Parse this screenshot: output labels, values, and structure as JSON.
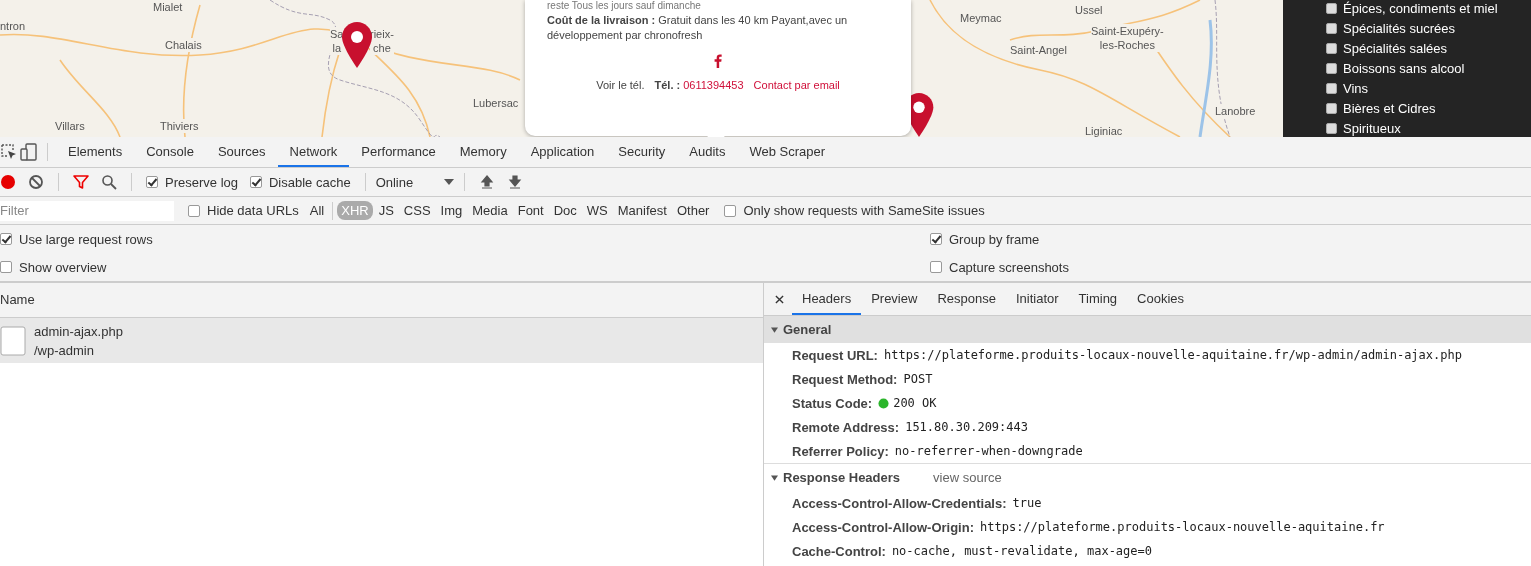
{
  "map": {
    "labels": [
      {
        "lines": [
          "ntron"
        ]
      },
      {
        "lines": [
          "Mialet"
        ]
      },
      {
        "lines": [
          "Chalais"
        ]
      },
      {
        "lines": [
          "Villars"
        ]
      },
      {
        "lines": [
          "Thiviers"
        ]
      },
      {
        "lines": [
          "Sa",
          "la"
        ]
      },
      {
        "lines": [
          "rieix-",
          "che"
        ]
      },
      {
        "lines": [
          "Lubersac"
        ]
      },
      {
        "lines": [
          "Meymac"
        ]
      },
      {
        "lines": [
          "Ussel"
        ]
      },
      {
        "lines": [
          "Saint-Exupéry-",
          "les-Roches"
        ]
      },
      {
        "lines": [
          "Saint-Angel"
        ]
      },
      {
        "lines": [
          "Lanobre"
        ]
      },
      {
        "lines": [
          "Liginiac"
        ]
      }
    ],
    "popup": {
      "hours": "reste Tous les jours sauf dimanche",
      "delivery_label": "Coût de la livraison :",
      "delivery_text": "Gratuit dans les 40 km Payant,avec un développement par chronofresh",
      "show_phone": "Voir le tél.",
      "phone_label": "Tél. :",
      "phone": "0611394453",
      "email_link": "Contact par email"
    }
  },
  "categories": [
    {
      "label": "Épices, condiments et miel",
      "checked": false
    },
    {
      "label": "Spécialités sucrées",
      "checked": false
    },
    {
      "label": "Spécialités salées",
      "checked": false
    },
    {
      "label": "Boissons sans alcool",
      "checked": false
    },
    {
      "label": "Vins",
      "checked": false
    },
    {
      "label": "Bières et Cidres",
      "checked": false
    },
    {
      "label": "Spiritueux",
      "checked": false
    }
  ],
  "devtools": {
    "tabs": [
      {
        "label": "Elements",
        "selected": false
      },
      {
        "label": "Console",
        "selected": false
      },
      {
        "label": "Sources",
        "selected": false
      },
      {
        "label": "Network",
        "selected": true
      },
      {
        "label": "Performance",
        "selected": false
      },
      {
        "label": "Memory",
        "selected": false
      },
      {
        "label": "Application",
        "selected": false
      },
      {
        "label": "Security",
        "selected": false
      },
      {
        "label": "Audits",
        "selected": false
      },
      {
        "label": "Web Scraper",
        "selected": false
      }
    ],
    "toolbar": {
      "recording": true,
      "preserve_log": {
        "label": "Preserve log",
        "checked": true
      },
      "disable_cache": {
        "label": "Disable cache",
        "checked": true
      },
      "throttling": "Online"
    },
    "filter": {
      "placeholder": "Filter",
      "hide_data_urls": {
        "label": "Hide data URLs",
        "checked": false
      },
      "types": [
        {
          "label": "All",
          "selected": false
        },
        {
          "label": "XHR",
          "selected": true
        },
        {
          "label": "JS",
          "selected": false
        },
        {
          "label": "CSS",
          "selected": false
        },
        {
          "label": "Img",
          "selected": false
        },
        {
          "label": "Media",
          "selected": false
        },
        {
          "label": "Font",
          "selected": false
        },
        {
          "label": "Doc",
          "selected": false
        },
        {
          "label": "WS",
          "selected": false
        },
        {
          "label": "Manifest",
          "selected": false
        },
        {
          "label": "Other",
          "selected": false
        }
      ],
      "samesite": {
        "label": "Only show requests with SameSite issues",
        "checked": false
      }
    },
    "settings_left": [
      {
        "label": "Use large request rows",
        "checked": true
      },
      {
        "label": "Show overview",
        "checked": false
      }
    ],
    "settings_right": [
      {
        "label": "Group by frame",
        "checked": true
      },
      {
        "label": "Capture screenshots",
        "checked": false
      }
    ],
    "requests_header": "Name",
    "requests": [
      {
        "name": "admin-ajax.php",
        "path": "/wp-admin",
        "selected": true
      }
    ],
    "detail_tabs": [
      {
        "label": "Headers",
        "selected": true
      },
      {
        "label": "Preview",
        "selected": false
      },
      {
        "label": "Response",
        "selected": false
      },
      {
        "label": "Initiator",
        "selected": false
      },
      {
        "label": "Timing",
        "selected": false
      },
      {
        "label": "Cookies",
        "selected": false
      }
    ],
    "sections": [
      {
        "title": "General",
        "expanded": true,
        "rows": [
          {
            "key": "Request URL:",
            "value": "https://plateforme.produits-locaux-nouvelle-aquitaine.fr/wp-admin/admin-ajax.php"
          },
          {
            "key": "Request Method:",
            "value": "POST"
          },
          {
            "key": "Status Code:",
            "value": "200 OK",
            "kind": "status"
          },
          {
            "key": "Remote Address:",
            "value": "151.80.30.209:443"
          },
          {
            "key": "Referrer Policy:",
            "value": "no-referrer-when-downgrade"
          }
        ]
      },
      {
        "title": "Response Headers",
        "link": "view source",
        "expanded": true,
        "rows": [
          {
            "key": "Access-Control-Allow-Credentials:",
            "value": "true"
          },
          {
            "key": "Access-Control-Allow-Origin:",
            "value": "https://plateforme.produits-locaux-nouvelle-aquitaine.fr"
          },
          {
            "key": "Cache-Control:",
            "value": "no-cache, must-revalidate, max-age=0"
          }
        ]
      }
    ]
  }
}
